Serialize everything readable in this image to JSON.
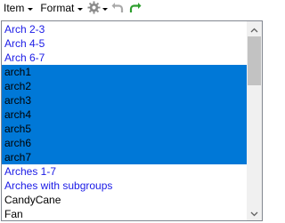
{
  "toolbar": {
    "item_menu": "Item",
    "format_menu": "Format",
    "gear_icon": "gear-icon",
    "undo_icon": "undo-icon",
    "redo_icon": "redo-icon",
    "redo_color": "#2e9e2e",
    "undo_color": "#a0a0a0"
  },
  "list": {
    "items": [
      {
        "label": "Arch 2-3",
        "style": "link"
      },
      {
        "label": "Arch 4-5",
        "style": "link"
      },
      {
        "label": "Arch 6-7",
        "style": "link"
      },
      {
        "label": "arch1",
        "style": "selected"
      },
      {
        "label": "arch2",
        "style": "selected"
      },
      {
        "label": "arch3",
        "style": "selected"
      },
      {
        "label": "arch4",
        "style": "selected"
      },
      {
        "label": "arch5",
        "style": "selected"
      },
      {
        "label": "arch6",
        "style": "selected"
      },
      {
        "label": "arch7",
        "style": "selected"
      },
      {
        "label": "Arches 1-7",
        "style": "link"
      },
      {
        "label": "Arches with subgroups",
        "style": "link"
      },
      {
        "label": "CandyCane",
        "style": "plain"
      },
      {
        "label": "Fan",
        "style": "plain"
      }
    ],
    "selection_color": "#0078d7",
    "link_color": "#1a1ae6"
  },
  "scrollbar": {
    "up_icon": "scroll-up-arrow-icon",
    "down_icon": "scroll-down-arrow-icon"
  }
}
